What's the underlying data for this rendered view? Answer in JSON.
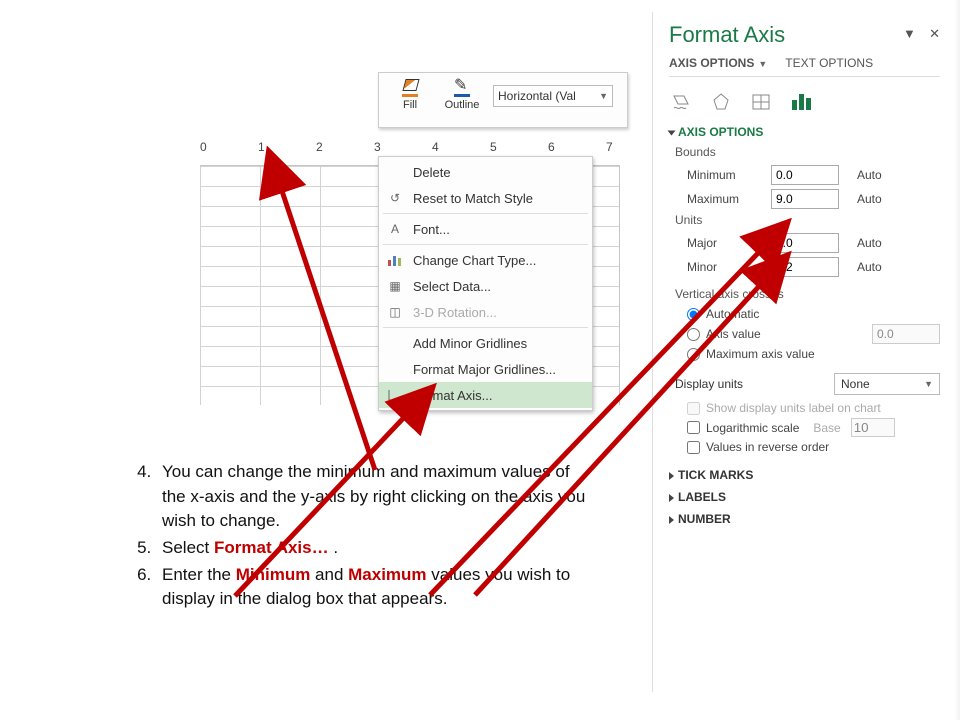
{
  "toolbar": {
    "fill_label": "Fill",
    "outline_label": "Outline",
    "shape_selector": "Horizontal (Val"
  },
  "axis_ticks": [
    "0",
    "1",
    "2",
    "3",
    "4",
    "5",
    "6",
    "7"
  ],
  "context_menu": {
    "delete": "Delete",
    "reset": "Reset to Match Style",
    "font": "Font...",
    "change_chart": "Change Chart Type...",
    "select_data": "Select Data...",
    "rotation_3d": "3-D Rotation...",
    "add_minor": "Add Minor Gridlines",
    "format_major": "Format Major Gridlines...",
    "format_axis": "Format Axis..."
  },
  "pane": {
    "title": "Format Axis",
    "tab_axis": "AXIS OPTIONS",
    "tab_text": "TEXT OPTIONS",
    "section_axis_options": "AXIS OPTIONS",
    "bounds_label": "Bounds",
    "min_label": "Minimum",
    "min_value": "0.0",
    "max_label": "Maximum",
    "max_value": "9.0",
    "units_label": "Units",
    "major_label": "Major",
    "major_value": "1.0",
    "minor_label": "Minor",
    "minor_value": "0.2",
    "auto": "Auto",
    "vcross": "Vertical axis crosses",
    "radio_auto": "Automatic",
    "radio_axisval": "Axis value",
    "axisval_value": "0.0",
    "radio_maxval": "Maximum axis value",
    "display_units": "Display units",
    "display_units_value": "None",
    "show_units_chk": "Show display units label on chart",
    "log_chk": "Logarithmic scale",
    "log_base_lbl": "Base",
    "log_base_val": "10",
    "reverse_chk": "Values in reverse order",
    "section_tick": "TICK MARKS",
    "section_labels": "LABELS",
    "section_number": "NUMBER"
  },
  "instructions": {
    "i4_a": "You can change the minimum and maximum values of the x-axis and the y-axis by right clicking on the axis you wish to change.",
    "i5_pre": "Select ",
    "i5_red": "Format Axis…",
    "i5_post": " .",
    "i6_pre": "Enter the ",
    "i6_red1": "Minimum",
    "i6_mid": " and ",
    "i6_red2": "Maximum",
    "i6_post": " values you wish to display in the dialog box that appears."
  }
}
